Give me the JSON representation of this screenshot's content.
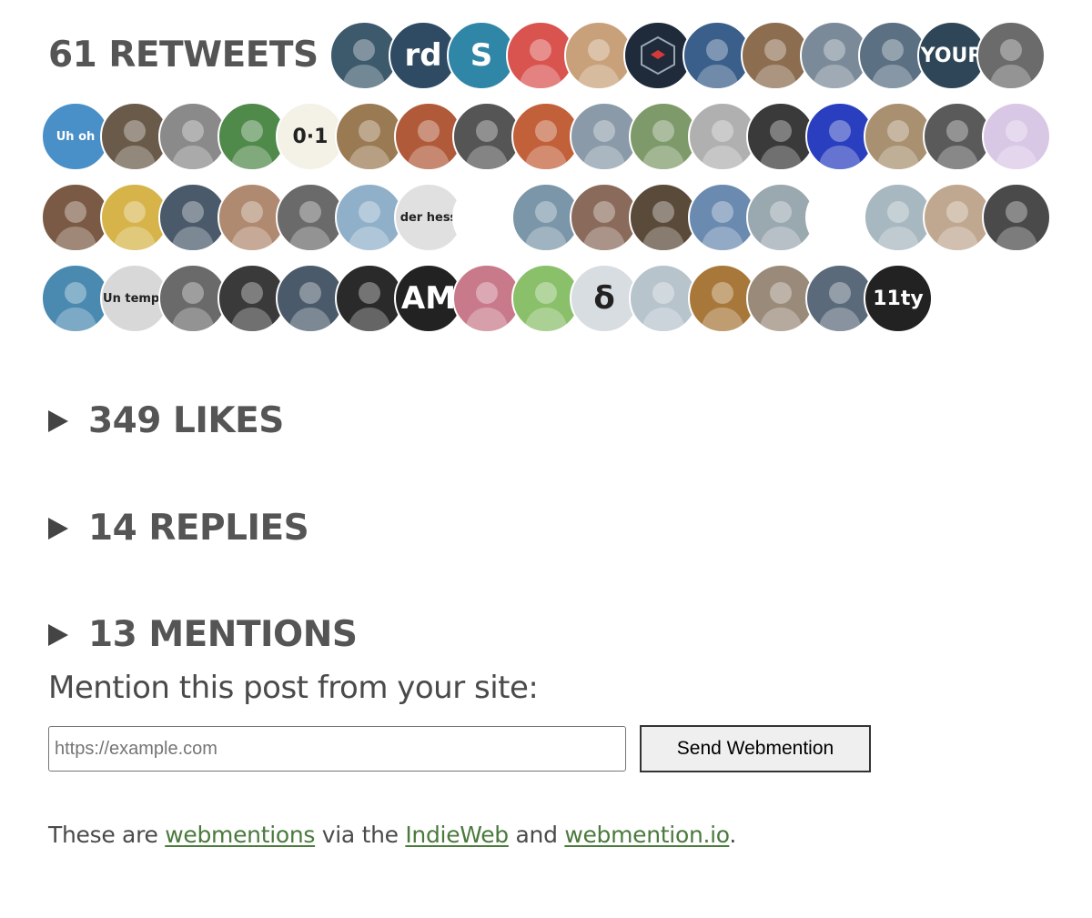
{
  "retweets": {
    "heading": "61 RETWEETS",
    "avatars": [
      {
        "color": "#3d5a6c",
        "icon": "person"
      },
      {
        "color": "#2f4b63",
        "label": "rd"
      },
      {
        "color": "#2f86a6",
        "label": "S"
      },
      {
        "color": "#d9534f",
        "icon": "person"
      },
      {
        "color": "#c8a17a",
        "icon": "person"
      },
      {
        "color": "#1f2a3a",
        "icon": "cube"
      },
      {
        "color": "#3a5f8a",
        "icon": "person"
      },
      {
        "color": "#8c6d4f",
        "icon": "person"
      },
      {
        "color": "#7a8a99",
        "icon": "person"
      },
      {
        "color": "#5b7083",
        "icon": "person"
      },
      {
        "color": "#2e4657",
        "label": "YOUR"
      },
      {
        "color": "#6b6b6b",
        "icon": "person"
      },
      {
        "color": "#4a90c8",
        "label": "Uh oh"
      },
      {
        "color": "#6a5a4a",
        "icon": "person"
      },
      {
        "color": "#8a8a8a",
        "icon": "person"
      },
      {
        "color": "#4f8a4a",
        "icon": "person"
      },
      {
        "color": "#f4f1e6",
        "label": "0·1",
        "dark": true
      },
      {
        "color": "#9a7a52",
        "icon": "person"
      },
      {
        "color": "#b05a3a",
        "icon": "person"
      },
      {
        "color": "#555555",
        "icon": "person"
      },
      {
        "color": "#c2603a",
        "icon": "person"
      },
      {
        "color": "#8a9aa8",
        "icon": "person"
      },
      {
        "color": "#7f9a6a",
        "icon": "person"
      },
      {
        "color": "#b0b0b0",
        "icon": "person"
      },
      {
        "color": "#3a3a3a",
        "icon": "person"
      },
      {
        "color": "#2a3fbf",
        "icon": "person"
      },
      {
        "color": "#a89070",
        "icon": "person"
      },
      {
        "color": "#5a5a5a",
        "icon": "person"
      },
      {
        "color": "#d9c7e6",
        "icon": "person"
      },
      {
        "color": "#7a5a44",
        "icon": "person"
      },
      {
        "color": "#d6b44a",
        "icon": "person"
      },
      {
        "color": "#4a5a6a",
        "icon": "person"
      },
      {
        "color": "#b08a70",
        "icon": "person"
      },
      {
        "color": "#6a6a6a",
        "icon": "person"
      },
      {
        "color": "#8fb0c8",
        "icon": "person"
      },
      {
        "color": "#e0e0e0",
        "label": "der hess",
        "dark": true
      },
      {
        "color": "#ffffff",
        "icon": "person"
      },
      {
        "color": "#7a96a8",
        "icon": "person"
      },
      {
        "color": "#8a6a5a",
        "icon": "person"
      },
      {
        "color": "#5a4a3a",
        "icon": "person"
      },
      {
        "color": "#6a8ab0",
        "icon": "person"
      },
      {
        "color": "#9aa8b0",
        "icon": "person"
      },
      {
        "color": "#ffffff",
        "icon": "person"
      },
      {
        "color": "#a8b8c0",
        "icon": "person"
      },
      {
        "color": "#c0a890",
        "icon": "person"
      },
      {
        "color": "#4a4a4a",
        "icon": "person"
      },
      {
        "color": "#4a8ab0",
        "icon": "person"
      },
      {
        "color": "#d8d8d8",
        "label": "Un temps",
        "dark": true
      },
      {
        "color": "#6a6a6a",
        "icon": "person"
      },
      {
        "color": "#3a3a3a",
        "icon": "person"
      },
      {
        "color": "#4a5a6a",
        "icon": "person"
      },
      {
        "color": "#2a2a2a",
        "icon": "person"
      },
      {
        "color": "#222222",
        "label": "AM"
      },
      {
        "color": "#c87a8a",
        "icon": "person"
      },
      {
        "color": "#8ac06a",
        "icon": "person"
      },
      {
        "color": "#d8dde2",
        "label": "δ",
        "dark": true
      },
      {
        "color": "#b8c4cc",
        "icon": "person"
      },
      {
        "color": "#a8783a",
        "icon": "person"
      },
      {
        "color": "#9a8a7a",
        "icon": "person"
      },
      {
        "color": "#5a6a7a",
        "icon": "person"
      },
      {
        "color": "#222222",
        "label": "11ty"
      }
    ]
  },
  "likes": {
    "label": "349 LIKES"
  },
  "replies": {
    "label": "14 REPLIES"
  },
  "mentions": {
    "label": "13 MENTIONS"
  },
  "mention_form": {
    "prompt": "Mention this post from your site:",
    "placeholder": "https://example.com",
    "button_label": "Send Webmention"
  },
  "footer": {
    "text_1": "These are ",
    "link_1": "webmentions",
    "text_2": " via the ",
    "link_2": "IndieWeb",
    "text_3": " and ",
    "link_3": "webmention.io",
    "text_4": "."
  }
}
